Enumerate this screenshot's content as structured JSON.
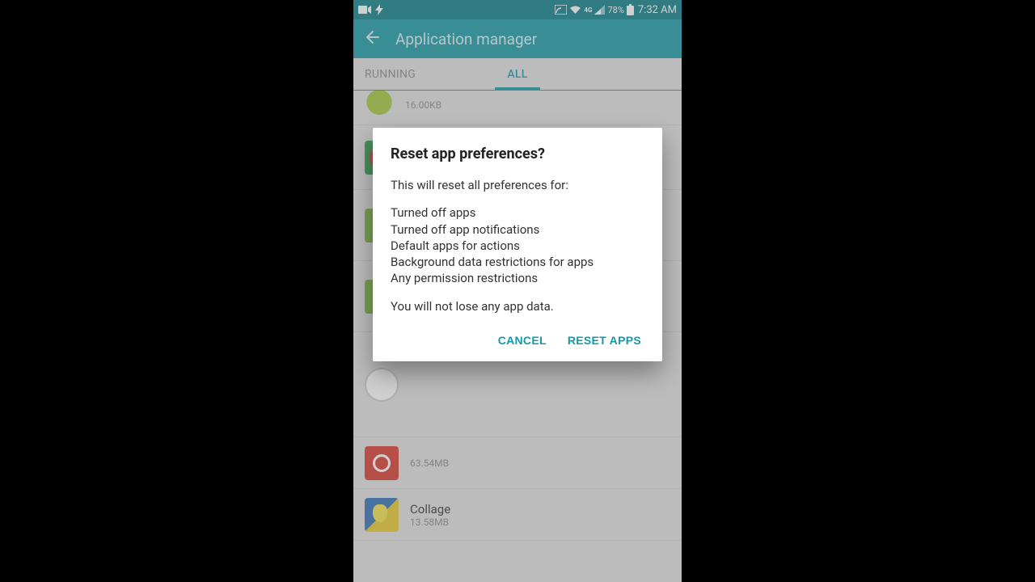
{
  "status": {
    "battery_pct": "78%",
    "time": "7:32 AM"
  },
  "header": {
    "title": "Application manager"
  },
  "tabs": {
    "running": "RUNNING",
    "all": "ALL"
  },
  "apps": {
    "row0_size": "16.00KB",
    "row_red_size": "63.54MB",
    "row_collage_name": "Collage",
    "row_collage_size": "13.58MB"
  },
  "dialog": {
    "title": "Reset app preferences?",
    "intro": "This will reset all preferences for:",
    "item1": "Turned off apps",
    "item2": "Turned off app notifications",
    "item3": "Default apps for actions",
    "item4": "Background data restrictions for apps",
    "item5": "Any permission restrictions",
    "footer": "You will not lose any app data.",
    "cancel": "CANCEL",
    "confirm": "RESET APPS"
  }
}
